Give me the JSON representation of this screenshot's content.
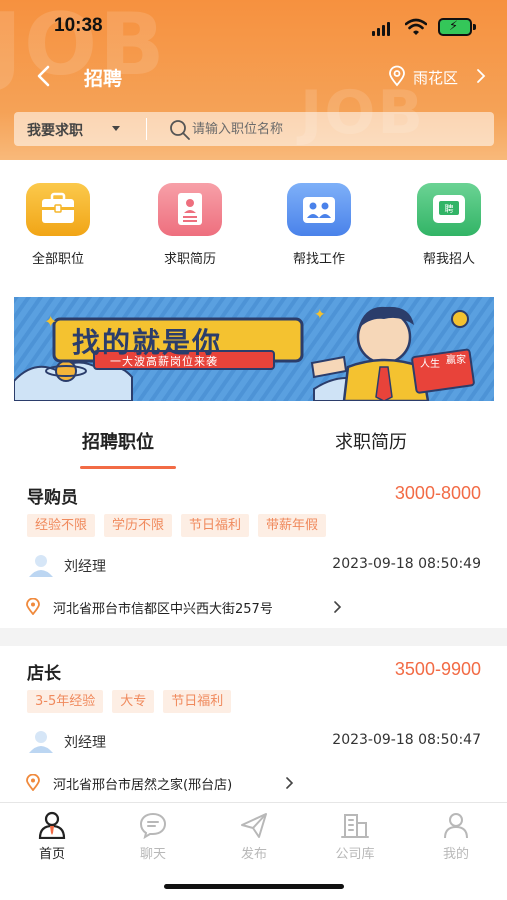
{
  "status_bar": {
    "time": "10:38"
  },
  "header": {
    "title": "招聘",
    "location": "雨花区",
    "watermark_1": "JOB",
    "watermark_2": "JOB"
  },
  "search": {
    "type_label": "我要求职",
    "placeholder": "请输入职位名称"
  },
  "categories": [
    {
      "label": "全部职位",
      "icon": "briefcase-icon",
      "color": "#f5b62b"
    },
    {
      "label": "求职简历",
      "icon": "resume-icon",
      "color": "#f06f80"
    },
    {
      "label": "帮找工作",
      "icon": "job-help-icon",
      "color": "#4f8bee"
    },
    {
      "label": "帮我招人",
      "icon": "recruit-icon",
      "color": "#3ebc72"
    }
  ],
  "banner": {
    "headline": "找的就是你",
    "subline": "一大波高薪岗位来袭",
    "book_text_1": "人生",
    "book_text_2": "赢家"
  },
  "tabs": [
    {
      "label": "招聘职位",
      "active": true
    },
    {
      "label": "求职简历",
      "active": false
    }
  ],
  "jobs": [
    {
      "title": "导购员",
      "salary": "3000-8000",
      "tags": [
        "经验不限",
        "学历不限",
        "节日福利",
        "带薪年假"
      ],
      "contact": "刘经理",
      "time": "2023-09-18 08:50:49",
      "address": "河北省邢台市信都区中兴西大街257号"
    },
    {
      "title": "店长",
      "salary": "3500-9900",
      "tags": [
        "3-5年经验",
        "大专",
        "节日福利"
      ],
      "contact": "刘经理",
      "time": "2023-09-18 08:50:47",
      "address": "河北省邢台市居然之家(邢台店)"
    }
  ],
  "tabbar": [
    {
      "label": "首页",
      "icon": "home-icon",
      "active": true
    },
    {
      "label": "聊天",
      "icon": "chat-icon",
      "active": false
    },
    {
      "label": "发布",
      "icon": "send-icon",
      "active": false
    },
    {
      "label": "公司库",
      "icon": "building-icon",
      "active": false
    },
    {
      "label": "我的",
      "icon": "profile-icon",
      "active": false
    }
  ],
  "colors": {
    "accent": "#f26b45",
    "header_orange": "#f6913f",
    "tag_bg": "#fdeee4",
    "tag_text": "#f08a5d"
  }
}
